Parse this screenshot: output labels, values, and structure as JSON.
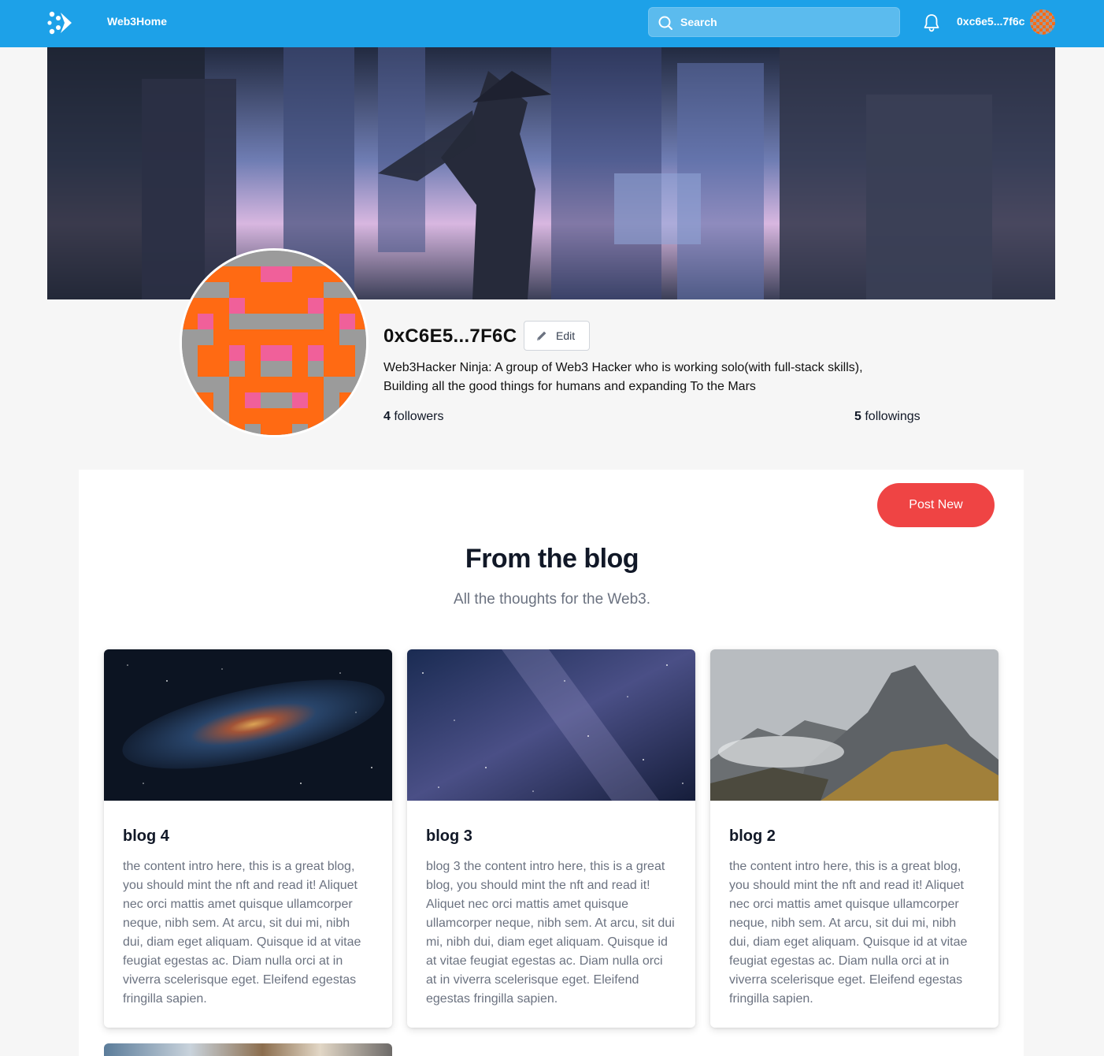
{
  "topbar": {
    "brand": "Web3Home",
    "search_placeholder": "Search",
    "account": "0xc6e5...7f6c"
  },
  "profile": {
    "handle": "0xC6E5...7F6C",
    "edit_label": "Edit",
    "bio_line1": "Web3Hacker Ninja: A group of Web3 Hacker who is working solo(with full-stack skills),",
    "bio_line2": "Building all the good things for humans and expanding To the Mars",
    "followers_count": "4",
    "followers_label": " followers",
    "followings_count": "5",
    "followings_label": " followings"
  },
  "blog": {
    "post_new": "Post New",
    "title": "From the blog",
    "subtitle": "All the thoughts for the Web3.",
    "posts": [
      {
        "title": "blog 4",
        "excerpt": "the content intro here, this is a great blog, you should mint the nft and read it! Aliquet nec orci mattis amet quisque ullamcorper neque, nibh sem. At arcu, sit dui mi, nibh dui, diam eget aliquam. Quisque id at vitae feugiat egestas ac. Diam nulla orci at in viverra scelerisque eget. Eleifend egestas fringilla sapien."
      },
      {
        "title": "blog 3",
        "excerpt": "blog 3 the content intro here, this is a great blog, you should mint the nft and read it! Aliquet nec orci mattis amet quisque ullamcorper neque, nibh sem. At arcu, sit dui mi, nibh dui, diam eget aliquam. Quisque id at vitae feugiat egestas ac. Diam nulla orci at in viverra scelerisque eget. Eleifend egestas fringilla sapien."
      },
      {
        "title": "blog 2",
        "excerpt": "the content intro here, this is a great blog, you should mint the nft and read it! Aliquet nec orci mattis amet quisque ullamcorper neque, nibh sem. At arcu, sit dui mi, nibh dui, diam eget aliquam. Quisque id at vitae feugiat egestas ac. Diam nulla orci at in viverra scelerisque eget. Eleifend egestas fringilla sapien."
      }
    ]
  },
  "colors": {
    "topbar": "#1da1e8",
    "accent_button": "#ef4444",
    "avatar_orange": "#ff6a13",
    "avatar_gray": "#9b9b9b",
    "avatar_pink": "#f0609a"
  },
  "icons": {
    "logo": "dots-arrow-logo-icon",
    "search": "search-icon",
    "notifications": "bell-icon",
    "edit": "pencil-icon"
  }
}
